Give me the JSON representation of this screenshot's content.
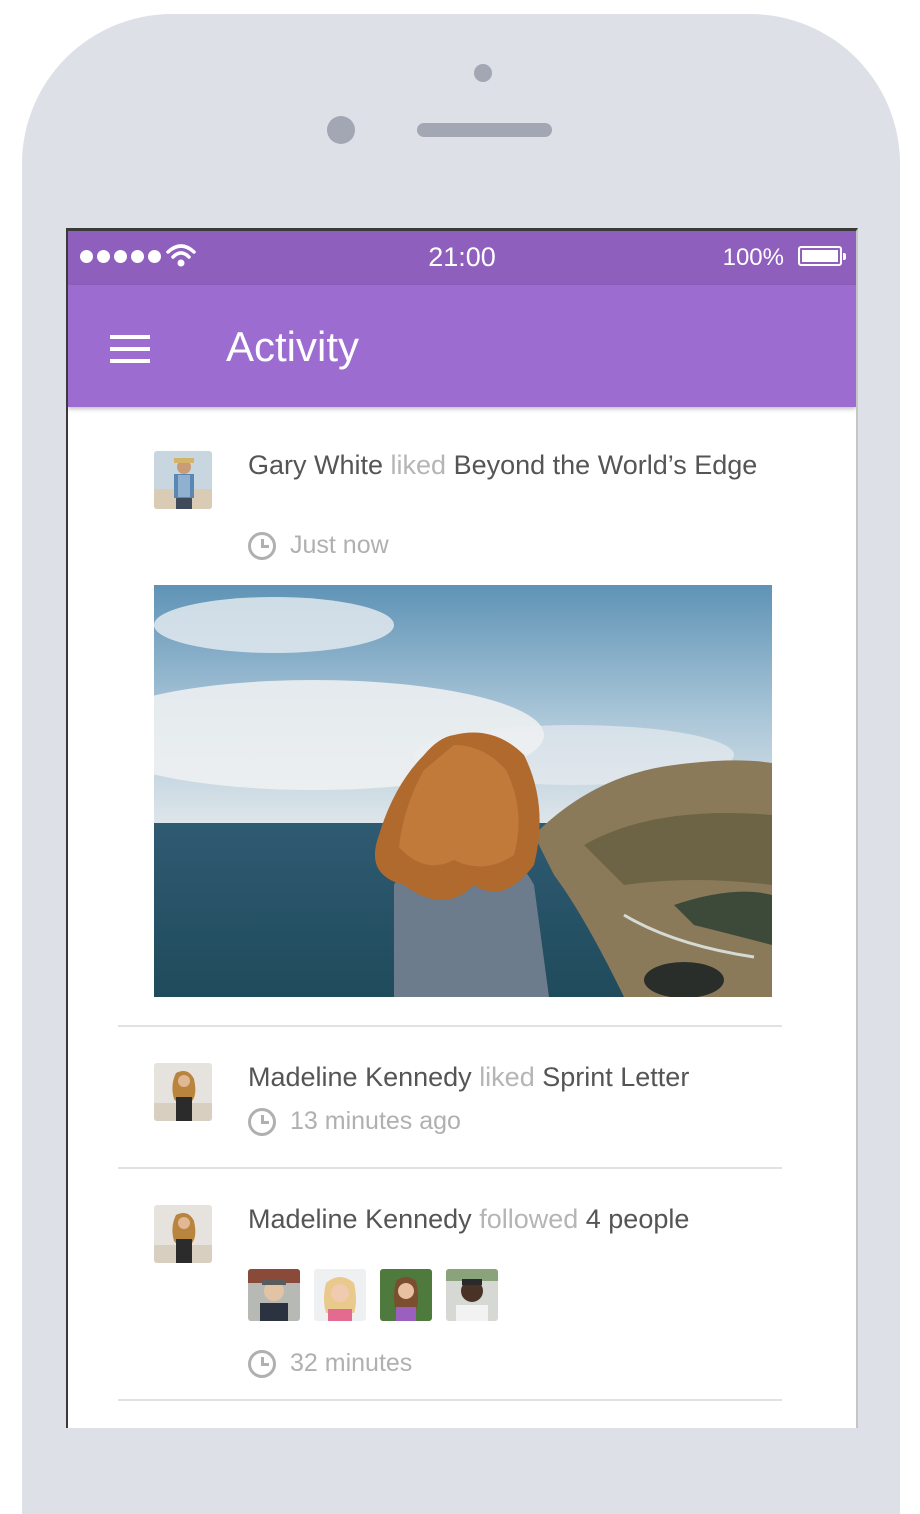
{
  "status_bar": {
    "time": "21:00",
    "battery": "100%"
  },
  "app_bar": {
    "title": "Activity"
  },
  "feed": [
    {
      "actor": "Gary White",
      "verb": "liked",
      "object": "Beyond the World’s Edge",
      "time": "Just now"
    },
    {
      "actor": "Madeline Kennedy",
      "verb": "liked",
      "object": "Sprint Letter",
      "time": "13 minutes ago"
    },
    {
      "actor": "Madeline Kennedy",
      "verb": "followed",
      "object": "4 people",
      "time": "32 minutes"
    }
  ],
  "colors": {
    "status_bar": "#8f5fbd",
    "app_bar": "#9c6cd1",
    "phone_frame": "#dde0e7"
  }
}
